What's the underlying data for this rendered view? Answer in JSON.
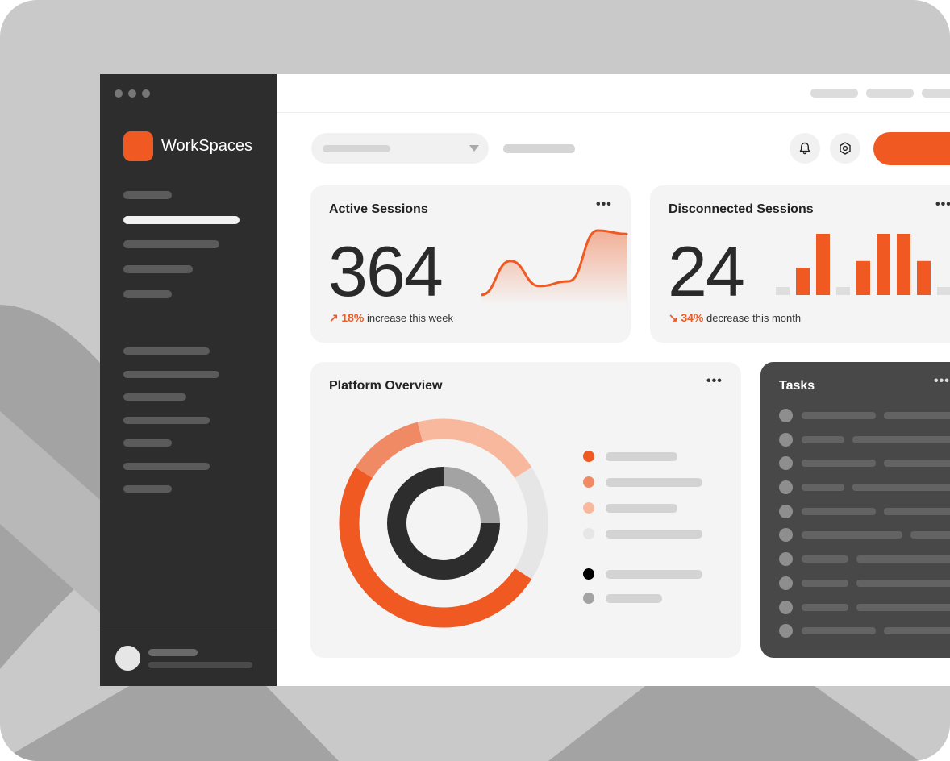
{
  "colors": {
    "accent": "#f05a22",
    "accent_mid": "#f08a65",
    "accent_light": "#f7b89e",
    "neutral_light": "#e6e6e6",
    "dark": "#2d2d2d",
    "gray": "#a3a3a3",
    "black": "#000000"
  },
  "brand": {
    "name": "WorkSpaces"
  },
  "topbar": {
    "notifications_icon": "bell-icon",
    "settings_icon": "hexagon-settings-icon"
  },
  "active_sessions": {
    "title": "Active Sessions",
    "value": "364",
    "delta_arrow": "↗",
    "delta_pct": "18%",
    "delta_text": "increase this week",
    "more": "•••"
  },
  "disconnected_sessions": {
    "title": "Disconnected Sessions",
    "value": "24",
    "delta_arrow": "↘",
    "delta_pct": "34%",
    "delta_text": "decrease this month",
    "more": "•••"
  },
  "platform_overview": {
    "title": "Platform Overview",
    "more": "•••"
  },
  "tasks": {
    "title": "Tasks",
    "more": "•••"
  },
  "chart_data": [
    {
      "type": "line",
      "series": [
        {
          "values": [
            0.05,
            0.55,
            0.18,
            0.25,
            1.0,
            0.95
          ]
        }
      ]
    },
    {
      "type": "bar",
      "values": [
        1,
        4,
        9,
        1,
        5,
        9,
        9,
        5,
        1
      ],
      "highlighted": [
        false,
        true,
        true,
        false,
        true,
        true,
        true,
        true,
        false
      ]
    },
    {
      "type": "pie",
      "outer_ring": [
        0.12,
        0.1,
        0.1,
        0.18,
        0.5
      ],
      "inner_ring": [
        0.25,
        0.75
      ]
    }
  ]
}
